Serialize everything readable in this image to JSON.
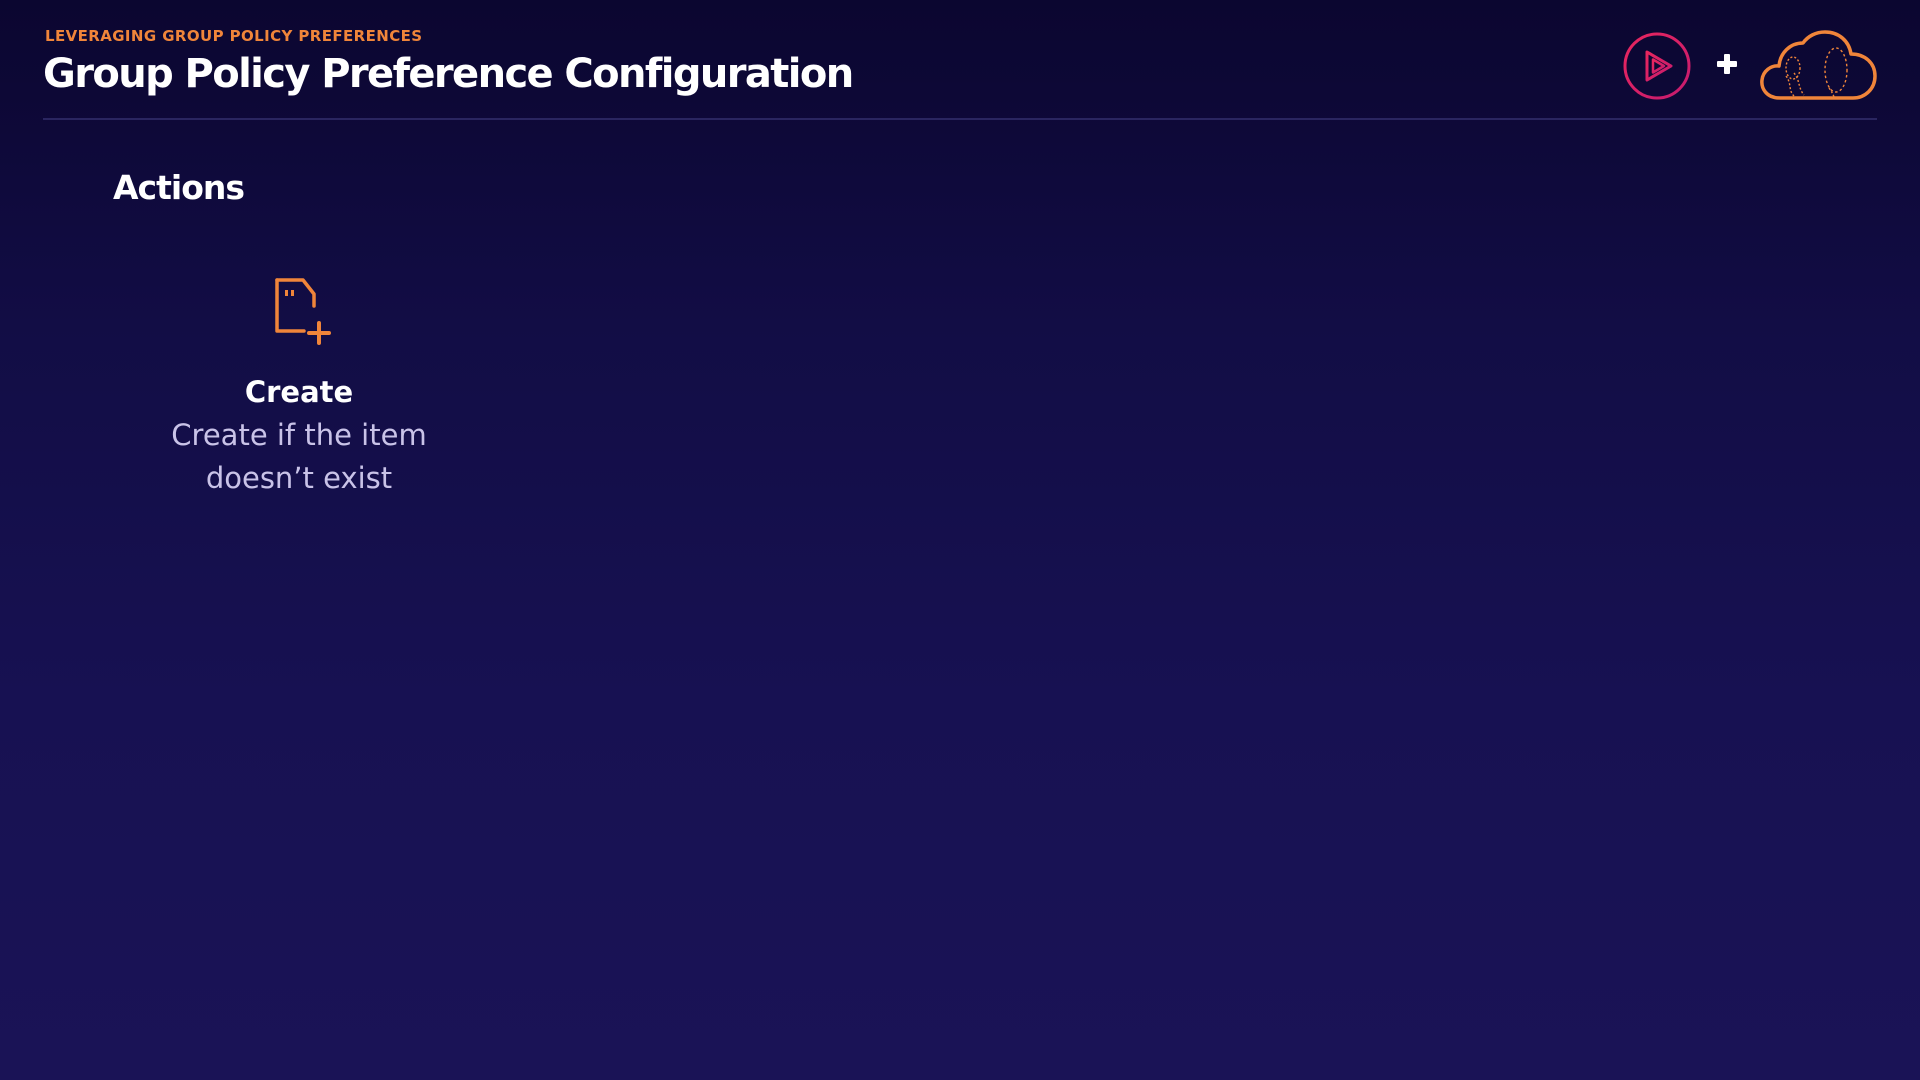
{
  "header": {
    "eyebrow": "LEVERAGING GROUP POLICY PREFERENCES",
    "title": "Group Policy Preference Configuration",
    "logos": {
      "left_icon": "play-logo-icon",
      "separator": "+",
      "right_icon": "cloud-logo-icon"
    }
  },
  "main": {
    "section_heading": "Actions",
    "actions": [
      {
        "icon": "file-add-icon",
        "title": "Create",
        "description": "Create if the item doesn’t exist"
      }
    ]
  },
  "colors": {
    "accent_orange": "#f0853a",
    "accent_pink": "#e8265e",
    "background_top": "#0b0630",
    "background_bottom": "#1a1356",
    "description_text": "#c9c3e8"
  }
}
